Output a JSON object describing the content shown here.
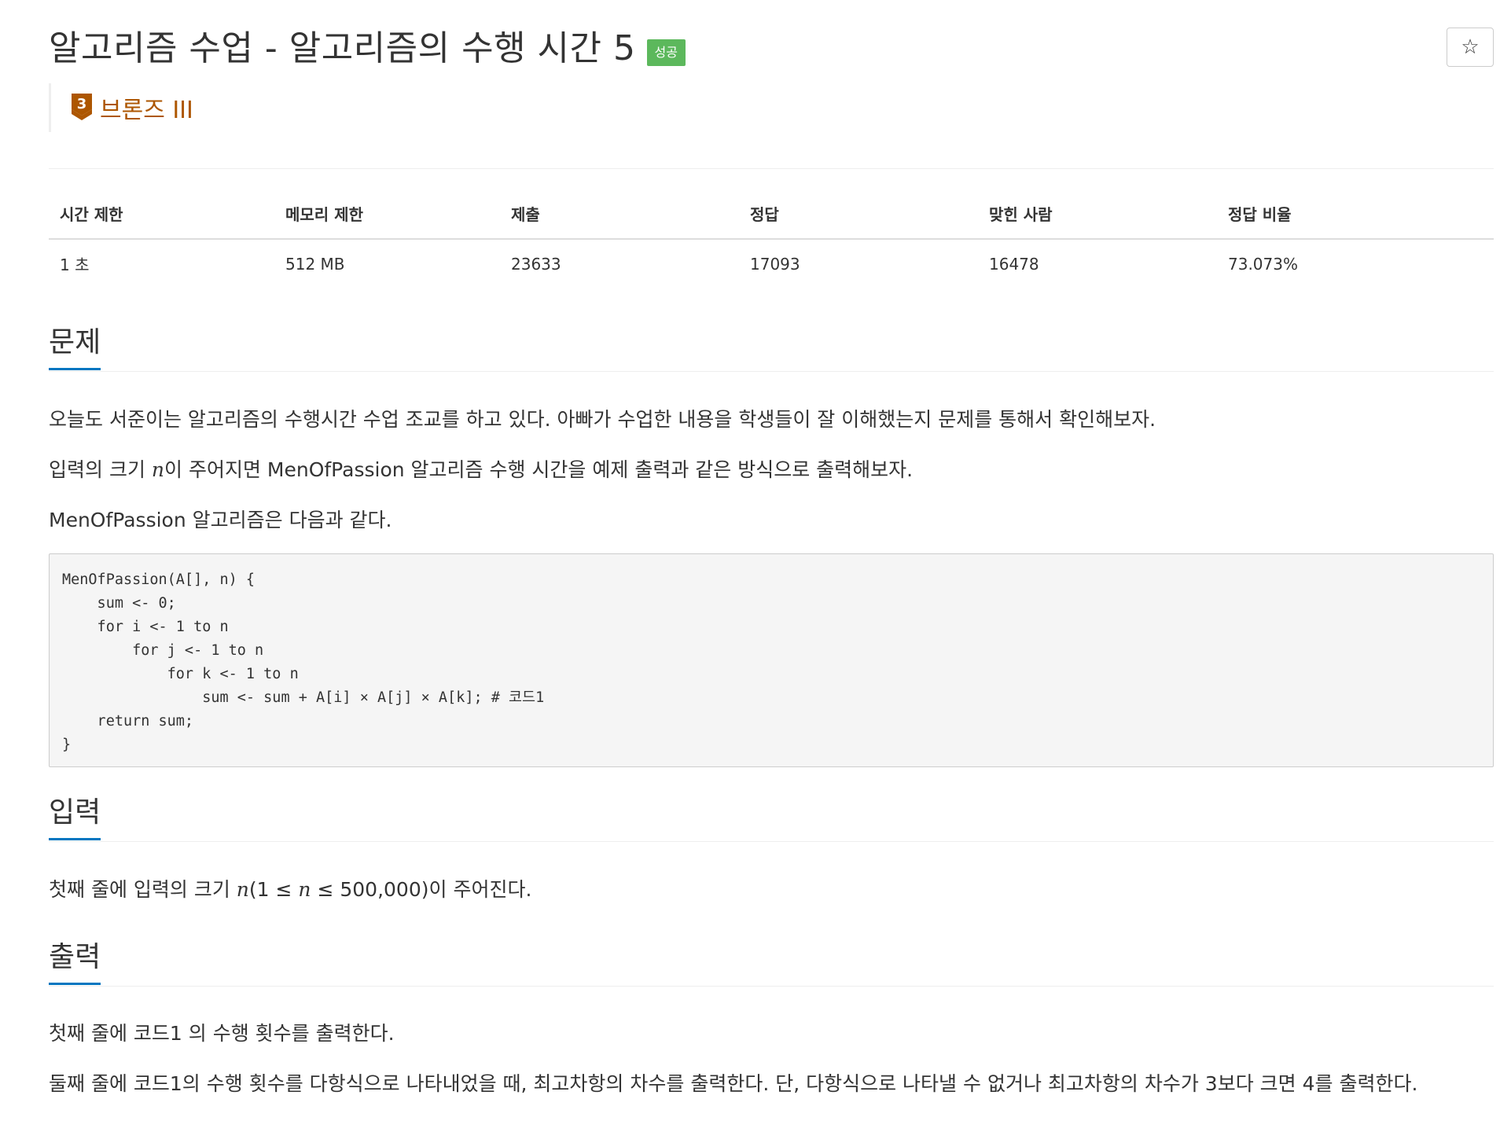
{
  "header": {
    "title": "알고리즘 수업 - 알고리즘의 수행 시간 5",
    "status_badge": "성공",
    "star_icon": "☆"
  },
  "tier": {
    "number": "3",
    "label": "브론즈 III",
    "color": "#ad5600"
  },
  "stats": {
    "headers": [
      "시간 제한",
      "메모리 제한",
      "제출",
      "정답",
      "맞힌 사람",
      "정답 비율"
    ],
    "values": [
      "1 초",
      "512 MB",
      "23633",
      "17093",
      "16478",
      "73.073%"
    ]
  },
  "problem": {
    "heading": "문제",
    "para1": "오늘도 서준이는 알고리즘의 수행시간 수업 조교를 하고 있다. 아빠가 수업한 내용을 학생들이 잘 이해했는지 문제를 통해서 확인해보자.",
    "para2_prefix": "입력의 크기 ",
    "para2_var": "n",
    "para2_suffix": "이 주어지면 MenOfPassion 알고리즘 수행 시간을 예제 출력과 같은 방식으로 출력해보자.",
    "para3": "MenOfPassion 알고리즘은 다음과 같다.",
    "code": "MenOfPassion(A[], n) {\n    sum <- 0;\n    for i <- 1 to n\n        for j <- 1 to n\n            for k <- 1 to n\n                sum <- sum + A[i] × A[j] × A[k]; # 코드1\n    return sum;\n}"
  },
  "input": {
    "heading": "입력",
    "text_prefix": "첫째 줄에 입력의 크기 ",
    "text_var1": "n",
    "text_mid": "(1 ≤ ",
    "text_var2": "n",
    "text_suffix": " ≤ 500,000)이 주어진다."
  },
  "output": {
    "heading": "출력",
    "para1": "첫째 줄에 코드1 의 수행 횟수를 출력한다.",
    "para2": "둘째 줄에 코드1의 수행 횟수를 다항식으로 나타내었을 때, 최고차항의 차수를 출력한다. 단, 다항식으로 나타낼 수 없거나 최고차항의 차수가 3보다 크면 4를 출력한다."
  },
  "colors": {
    "accent": "#0076c0",
    "success": "#5cb85c",
    "bronze": "#ad5600"
  }
}
